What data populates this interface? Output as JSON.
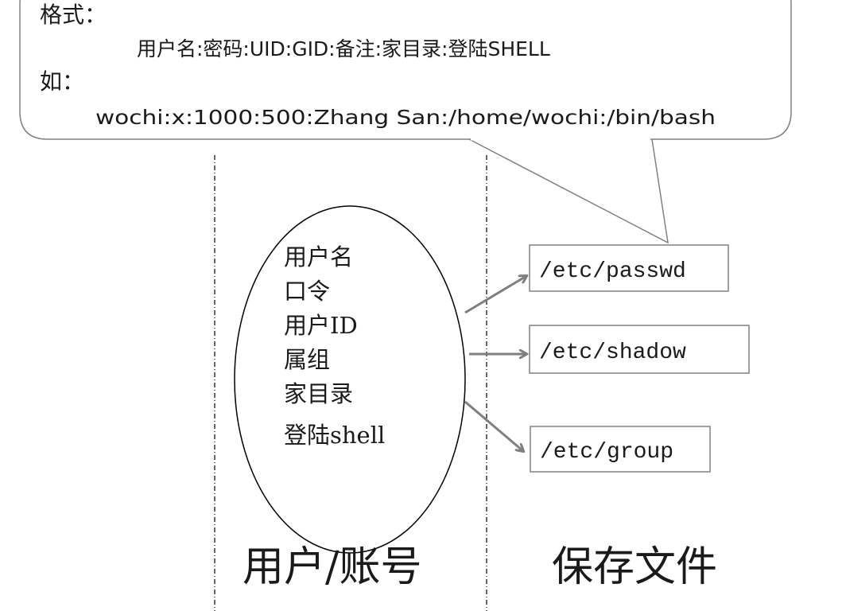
{
  "callout": {
    "format_label": "格式：",
    "format_spec": "用户名:密码:UID:GID:备注:家目录:登陆SHELL",
    "example_label": "如：",
    "example_value": "wochi:x:1000:500:Zhang San:/home/wochi:/bin/bash"
  },
  "account_fields": {
    "username": "用户名",
    "password": "口令",
    "user_id": "用户ID",
    "group": "属组",
    "home_dir": "家目录",
    "login_shell": "登陆shell"
  },
  "files": {
    "passwd": "/etc/passwd",
    "shadow": "/etc/shadow",
    "group": "/etc/group"
  },
  "columns": {
    "accounts": "用户/账号",
    "files": "保存文件"
  },
  "colors": {
    "line": "#808080",
    "border_dark": "#000000",
    "text": "#1a1a1a",
    "arrow": "#7f7f7f"
  }
}
